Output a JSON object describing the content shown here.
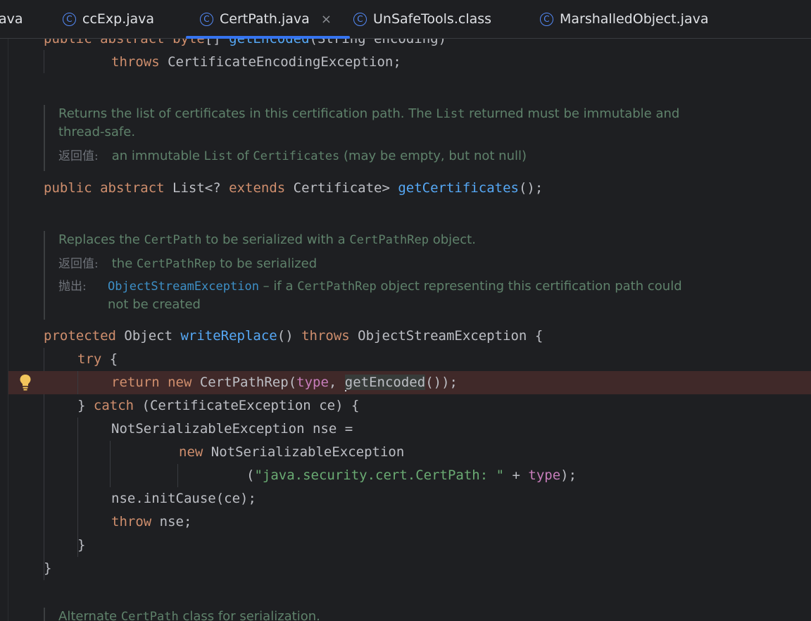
{
  "tabs": [
    {
      "label": "ava",
      "has_icon": false
    },
    {
      "label": "ccExp.java",
      "has_icon": true
    },
    {
      "label": "CertPath.java",
      "has_icon": true,
      "active": true
    },
    {
      "label": "UnSafeTools.class",
      "has_icon": true
    },
    {
      "label": "MarshalledObject.java",
      "has_icon": true
    }
  ],
  "tab_close_glyph": "×",
  "class_icon_glyph": "C",
  "colors": {
    "background": "#1e1f22",
    "keyword": "#cf8e6d",
    "method": "#56a8f5",
    "field": "#c77dbb",
    "string": "#6aab73",
    "doc": "#5f826b",
    "highlight_row": "#402929",
    "active_tab_underline": "#3574f0"
  },
  "code": {
    "line0": {
      "kw1": "public",
      "kw2": "abstract",
      "kw3": "byte",
      "rest": "[] ",
      "fn": "getEncoded",
      "tail": "(String encoding)"
    },
    "line1": {
      "kw": "throws",
      "rest": " CertificateEncodingException;"
    },
    "doc1": {
      "text_a": "Returns the list of certificates in this certification path. The ",
      "code_a": "List",
      "text_b": " returned must be immutable and thread-safe.",
      "returns_tag": "返回值:",
      "returns_a": " an immutable ",
      "returns_code_a": "List",
      "returns_b": " of ",
      "returns_code_b": "Certificates",
      "returns_c": " (may be empty, but not null)"
    },
    "line2": {
      "kw1": "public",
      "kw2": "abstract",
      "type": " List<? ",
      "kw3": "extends",
      "rest": " Certificate> ",
      "fn": "getCertificates",
      "tail": "();"
    },
    "doc2": {
      "text_a": "Replaces the ",
      "code_a": "CertPath",
      "text_b": " to be serialized with a ",
      "code_b": "CertPathRep",
      "text_c": " object.",
      "returns_tag": "返回值:",
      "returns_a": " the ",
      "returns_code": "CertPathRep",
      "returns_b": " to be serialized",
      "throws_tag": "抛出:",
      "throws_link": "ObjectStreamException",
      "throws_a": " – if a ",
      "throws_code": "CertPathRep",
      "throws_b": " object representing this certification path could not be created"
    },
    "line3": {
      "kw1": "protected",
      "t1": " Object ",
      "fn": "writeReplace",
      "t2": "() ",
      "kw2": "throws",
      "t3": " ObjectStreamException {"
    },
    "line4": {
      "kw": "try",
      "rest": " {"
    },
    "line5": {
      "kw1": "return",
      "kw2": "new",
      "t1": " CertPathRep(",
      "fld": "type",
      "t2": ", ",
      "sel": "getEncoded",
      "t3": "());"
    },
    "line6": {
      "t1": "} ",
      "kw": "catch",
      "t2": " (CertificateException ce) {"
    },
    "line7": {
      "text": "NotSerializableException nse ="
    },
    "line8": {
      "kw": "new",
      "rest": " NotSerializableException"
    },
    "line9": {
      "t1": "(",
      "str": "\"java.security.cert.CertPath: \"",
      "t2": " + ",
      "fld": "type",
      "t3": ");"
    },
    "line10": {
      "text": "nse.initCause(ce);"
    },
    "line11": {
      "kw": "throw",
      "rest": " nse;"
    },
    "line12": {
      "text": "}"
    },
    "line13": {
      "text": "}"
    },
    "doc3": {
      "text_a": "Alternate ",
      "code_a": "CertPath",
      "text_b": " class for serialization."
    }
  }
}
